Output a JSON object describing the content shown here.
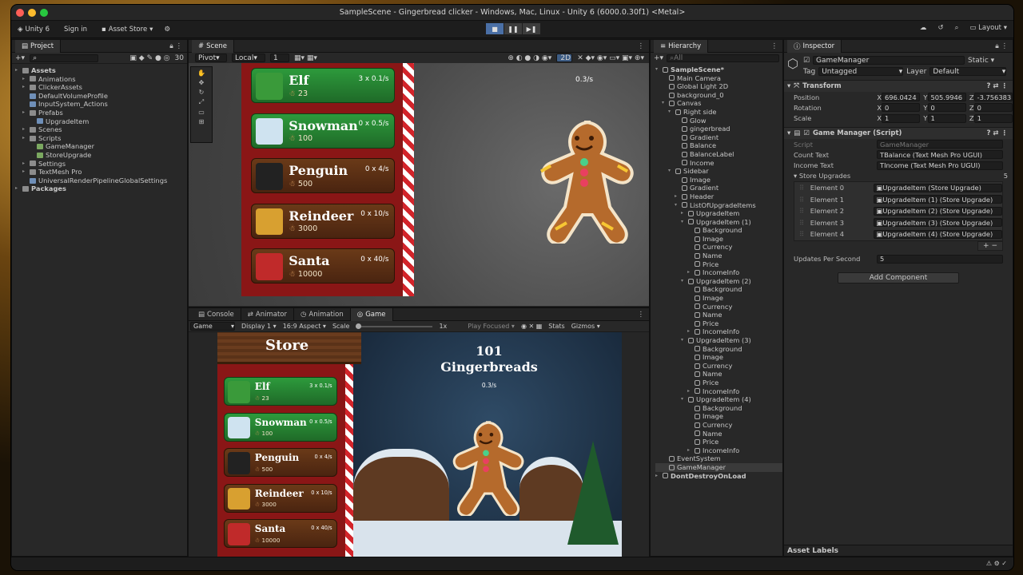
{
  "window": {
    "title": "SampleScene - Gingerbread clicker - Windows, Mac, Linux - Unity 6 (6000.0.30f1) <Metal>"
  },
  "toolbar": {
    "account": "Unity 6",
    "sign_in": "Sign in",
    "asset_store": "Asset Store",
    "layout": "Layout"
  },
  "project": {
    "tab": "Project",
    "search_count": "30",
    "items": [
      {
        "label": "Assets",
        "depth": 0,
        "bold": true,
        "icon": "folder"
      },
      {
        "label": "Animations",
        "depth": 1,
        "icon": "folder"
      },
      {
        "label": "ClickerAssets",
        "depth": 1,
        "icon": "folder"
      },
      {
        "label": "DefaultVolumeProfile",
        "depth": 1,
        "icon": "asset"
      },
      {
        "label": "InputSystem_Actions",
        "depth": 1,
        "icon": "asset"
      },
      {
        "label": "Prefabs",
        "depth": 1,
        "icon": "folder"
      },
      {
        "label": "UpgradeItem",
        "depth": 2,
        "icon": "prefab"
      },
      {
        "label": "Scenes",
        "depth": 1,
        "icon": "folder"
      },
      {
        "label": "Scripts",
        "depth": 1,
        "icon": "folder"
      },
      {
        "label": "GameManager",
        "depth": 2,
        "icon": "script"
      },
      {
        "label": "StoreUpgrade",
        "depth": 2,
        "icon": "script"
      },
      {
        "label": "Settings",
        "depth": 1,
        "icon": "folder"
      },
      {
        "label": "TextMesh Pro",
        "depth": 1,
        "icon": "folder"
      },
      {
        "label": "UniversalRenderPipelineGlobalSettings",
        "depth": 1,
        "icon": "asset"
      },
      {
        "label": "Packages",
        "depth": 0,
        "bold": true,
        "icon": "folder"
      }
    ]
  },
  "scene": {
    "tab": "Scene",
    "pivot": "Pivot",
    "local": "Local",
    "num": "1",
    "mode": "2D",
    "income": "0.3/s"
  },
  "store_items": [
    {
      "name": "Elf",
      "count": "3 x 0.1/s",
      "price": "23",
      "color": "green"
    },
    {
      "name": "Snowman",
      "count": "0 x 0.5/s",
      "price": "100",
      "color": "green"
    },
    {
      "name": "Penguin",
      "count": "0 x 4/s",
      "price": "500",
      "color": "brown"
    },
    {
      "name": "Reindeer",
      "count": "0 x 10/s",
      "price": "3000",
      "color": "brown"
    },
    {
      "name": "Santa",
      "count": "0 x 40/s",
      "price": "10000",
      "color": "brown"
    }
  ],
  "bottom_tabs": [
    "Console",
    "Animator",
    "Animation",
    "Game"
  ],
  "game_bar": {
    "game": "Game",
    "display": "Display 1",
    "aspect": "16:9 Aspect",
    "scale": "Scale",
    "scale_val": "1x",
    "play_focused": "Play Focused",
    "stats": "Stats",
    "gizmos": "Gizmos"
  },
  "game": {
    "store_title": "Store",
    "count": "101",
    "label": "Gingerbreads",
    "income": "0.3/s"
  },
  "hierarchy": {
    "tab": "Hierarchy",
    "search": "All",
    "items": [
      {
        "label": "SampleScene*",
        "depth": 0
      },
      {
        "label": "Main Camera",
        "depth": 1
      },
      {
        "label": "Global Light 2D",
        "depth": 1
      },
      {
        "label": "background_0",
        "depth": 1
      },
      {
        "label": "Canvas",
        "depth": 1
      },
      {
        "label": "Right side",
        "depth": 2
      },
      {
        "label": "Glow",
        "depth": 3
      },
      {
        "label": "gingerbread",
        "depth": 3
      },
      {
        "label": "Gradient",
        "depth": 3
      },
      {
        "label": "Balance",
        "depth": 3
      },
      {
        "label": "BalanceLabel",
        "depth": 3
      },
      {
        "label": "Income",
        "depth": 3
      },
      {
        "label": "Sidebar",
        "depth": 2
      },
      {
        "label": "Image",
        "depth": 3
      },
      {
        "label": "Gradient",
        "depth": 3
      },
      {
        "label": "Header",
        "depth": 3
      },
      {
        "label": "ListOfUpgradeItems",
        "depth": 3
      },
      {
        "label": "UpgradeItem",
        "depth": 4
      },
      {
        "label": "UpgradeItem (1)",
        "depth": 4
      },
      {
        "label": "Background",
        "depth": 5
      },
      {
        "label": "Image",
        "depth": 5
      },
      {
        "label": "Currency",
        "depth": 5
      },
      {
        "label": "Name",
        "depth": 5
      },
      {
        "label": "Price",
        "depth": 5
      },
      {
        "label": "IncomeInfo",
        "depth": 5
      },
      {
        "label": "UpgradeItem (2)",
        "depth": 4
      },
      {
        "label": "Background",
        "depth": 5
      },
      {
        "label": "Image",
        "depth": 5
      },
      {
        "label": "Currency",
        "depth": 5
      },
      {
        "label": "Name",
        "depth": 5
      },
      {
        "label": "Price",
        "depth": 5
      },
      {
        "label": "IncomeInfo",
        "depth": 5
      },
      {
        "label": "UpgradeItem (3)",
        "depth": 4
      },
      {
        "label": "Background",
        "depth": 5
      },
      {
        "label": "Image",
        "depth": 5
      },
      {
        "label": "Currency",
        "depth": 5
      },
      {
        "label": "Name",
        "depth": 5
      },
      {
        "label": "Price",
        "depth": 5
      },
      {
        "label": "IncomeInfo",
        "depth": 5
      },
      {
        "label": "UpgradeItem (4)",
        "depth": 4
      },
      {
        "label": "Background",
        "depth": 5
      },
      {
        "label": "Image",
        "depth": 5
      },
      {
        "label": "Currency",
        "depth": 5
      },
      {
        "label": "Name",
        "depth": 5
      },
      {
        "label": "Price",
        "depth": 5
      },
      {
        "label": "IncomeInfo",
        "depth": 5
      },
      {
        "label": "EventSystem",
        "depth": 1
      },
      {
        "label": "GameManager",
        "depth": 1,
        "selected": true
      },
      {
        "label": "DontDestroyOnLoad",
        "depth": 0
      }
    ]
  },
  "inspector": {
    "tab": "Inspector",
    "object": "GameManager",
    "static": "Static",
    "tag_label": "Tag",
    "tag": "Untagged",
    "layer_label": "Layer",
    "layer": "Default",
    "transform": "Transform",
    "position": {
      "label": "Position",
      "x": "696.0424",
      "y": "505.9946",
      "z": "-3.756383"
    },
    "rotation": {
      "label": "Rotation",
      "x": "0",
      "y": "0",
      "z": "0"
    },
    "scale": {
      "label": "Scale",
      "x": "1",
      "y": "1",
      "z": "1"
    },
    "script_comp": "Game Manager (Script)",
    "script_label": "Script",
    "script_val": "GameManager",
    "count_text_label": "Count Text",
    "count_text": "Balance (Text Mesh Pro UGUI)",
    "income_text_label": "Income Text",
    "income_text": "Income (Text Mesh Pro UGUI)",
    "store_label": "Store Upgrades",
    "store_count": "5",
    "elements": [
      {
        "label": "Element 0",
        "val": "UpgradeItem (Store Upgrade)"
      },
      {
        "label": "Element 1",
        "val": "UpgradeItem (1) (Store Upgrade)"
      },
      {
        "label": "Element 2",
        "val": "UpgradeItem (2) (Store Upgrade)"
      },
      {
        "label": "Element 3",
        "val": "UpgradeItem (3) (Store Upgrade)"
      },
      {
        "label": "Element 4",
        "val": "UpgradeItem (4) (Store Upgrade)"
      }
    ],
    "ups_label": "Updates Per Second",
    "ups": "5",
    "add_component": "Add Component",
    "asset_labels": "Asset Labels"
  }
}
